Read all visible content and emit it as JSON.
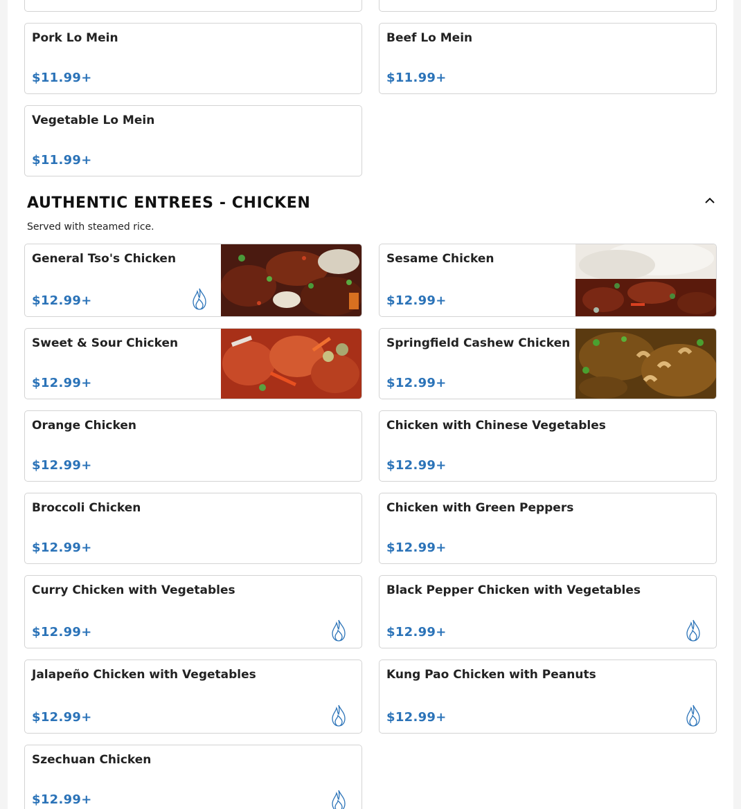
{
  "lo_mein_items": [
    {
      "name": "Pork Lo Mein",
      "price": "$11.99+"
    },
    {
      "name": "Beef Lo Mein",
      "price": "$11.99+"
    },
    {
      "name": "Vegetable Lo Mein",
      "price": "$11.99+"
    }
  ],
  "section": {
    "title": "AUTHENTIC ENTREES - CHICKEN",
    "description": "Served with steamed rice.",
    "collapse_icon": "chevron-up-icon"
  },
  "chicken_items": [
    {
      "name": "General Tso's Chicken",
      "price": "$12.99+",
      "image": "general-tso-chicken-photo",
      "spicy": true
    },
    {
      "name": "Sesame Chicken",
      "price": "$12.99+",
      "image": "sesame-chicken-photo",
      "spicy": false
    },
    {
      "name": "Sweet & Sour Chicken",
      "price": "$12.99+",
      "image": "sweet-sour-chicken-photo",
      "spicy": false
    },
    {
      "name": "Springfield Cashew Chicken",
      "price": "$12.99+",
      "image": "cashew-chicken-photo",
      "spicy": false
    },
    {
      "name": "Orange Chicken",
      "price": "$12.99+",
      "spicy": false
    },
    {
      "name": "Chicken with Chinese Vegetables",
      "price": "$12.99+",
      "spicy": false
    },
    {
      "name": "Broccoli Chicken",
      "price": "$12.99+",
      "spicy": false
    },
    {
      "name": "Chicken with Green Peppers",
      "price": "$12.99+",
      "spicy": false
    },
    {
      "name": "Curry Chicken with Vegetables",
      "price": "$12.99+",
      "spicy": true
    },
    {
      "name": "Black Pepper Chicken with Vegetables",
      "price": "$12.99+",
      "spicy": true
    },
    {
      "name": "Jalapeño Chicken with Vegetables",
      "price": "$12.99+",
      "spicy": true
    },
    {
      "name": "Kung Pao Chicken with Peanuts",
      "price": "$12.99+",
      "spicy": true
    },
    {
      "name": "Szechuan Chicken",
      "price": "$12.99+",
      "spicy": true
    }
  ],
  "colors": {
    "price": "#2b73b8",
    "spicy_icon": "#2b73b8",
    "card_border": "#d3d3d3"
  },
  "icons": {
    "spicy": "flame-icon"
  }
}
